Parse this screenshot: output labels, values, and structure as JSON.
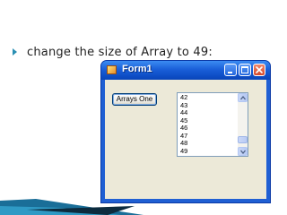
{
  "slide": {
    "bullet_text": "change the size of Array to 49:"
  },
  "window": {
    "title": "Form1",
    "accent_color": "#1f5fd3",
    "client_color": "#ece9d8"
  },
  "form": {
    "button_label": "Arrays One",
    "list_items": [
      "42",
      "43",
      "44",
      "45",
      "46",
      "47",
      "48",
      "49"
    ]
  },
  "icons": {
    "bullet": "triangle-bullet-icon",
    "app": "form-app-icon",
    "minimize": "minimize-icon",
    "maximize": "maximize-icon",
    "close": "close-icon",
    "scroll_up": "chevron-up-icon",
    "scroll_down": "chevron-down-icon"
  }
}
